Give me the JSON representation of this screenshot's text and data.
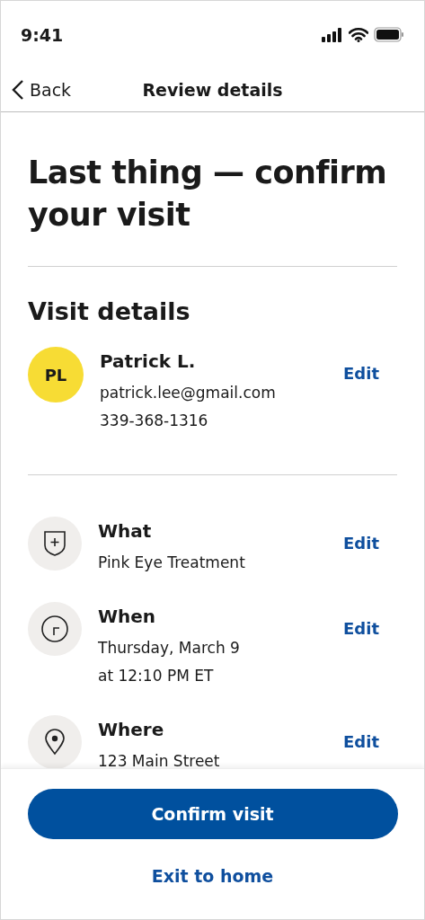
{
  "status_bar": {
    "time": "9:41"
  },
  "nav": {
    "back": "Back",
    "title": "Review details"
  },
  "heading": "Last thing — confirm your visit",
  "section_title": "Visit details",
  "patient": {
    "initials": "PL",
    "name": "Patrick L.",
    "email": "patrick.lee@gmail.com",
    "phone": "339-368-1316",
    "action": "Edit"
  },
  "details": [
    {
      "kind": "shield",
      "label": "What",
      "lines": [
        "Pink Eye Treatment"
      ],
      "action": "Edit"
    },
    {
      "kind": "clock",
      "label": "When",
      "lines": [
        "Thursday, March 9",
        "at 12:10 PM ET"
      ],
      "action": "Edit"
    },
    {
      "kind": "pin",
      "label": "Where",
      "lines": [
        "123 Main Street"
      ],
      "action": "Edit"
    }
  ],
  "primary_button": "Confirm visit",
  "secondary_link": "Exit to home"
}
